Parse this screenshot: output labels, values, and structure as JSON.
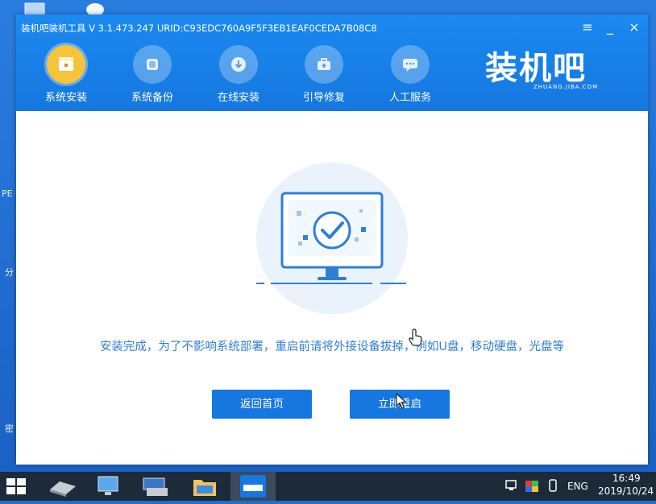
{
  "app": {
    "title": "装机吧装机工具 V 3.1.473.247 URID:C93EDC760A9F5F3EB1EAF0CEDA7B08C8",
    "window_controls": [
      "≡",
      "_",
      "×"
    ],
    "nav": [
      {
        "label": "系统安装",
        "icon": "system-install-icon",
        "active": true
      },
      {
        "label": "系统备份",
        "icon": "backup-icon",
        "active": false
      },
      {
        "label": "在线安装",
        "icon": "download-icon",
        "active": false
      },
      {
        "label": "引导修复",
        "icon": "toolbox-icon",
        "active": false
      },
      {
        "label": "人工服务",
        "icon": "chat-icon",
        "active": false
      }
    ],
    "logo": {
      "main": "装机吧",
      "sub": "ZHUANG.JIBA.COM"
    }
  },
  "content": {
    "message": "安装完成，为了不影响系统部署，重启前请将外接设备拔掉，例如U盘，移动硬盘，光盘等",
    "buttons": {
      "home": "返回首页",
      "restart": "立即重启"
    }
  },
  "taskbar": {
    "time": "16:49",
    "date": "2019/10/24",
    "lang": "ENG"
  },
  "desktop_fragments": {
    "pe": "PE",
    "fen": "分",
    "mi": "密"
  },
  "colors": {
    "accent": "#1677e0",
    "nav_active": "#f6c33a",
    "message_text": "#2f7fd7",
    "taskbar": "#1d2a3a"
  }
}
